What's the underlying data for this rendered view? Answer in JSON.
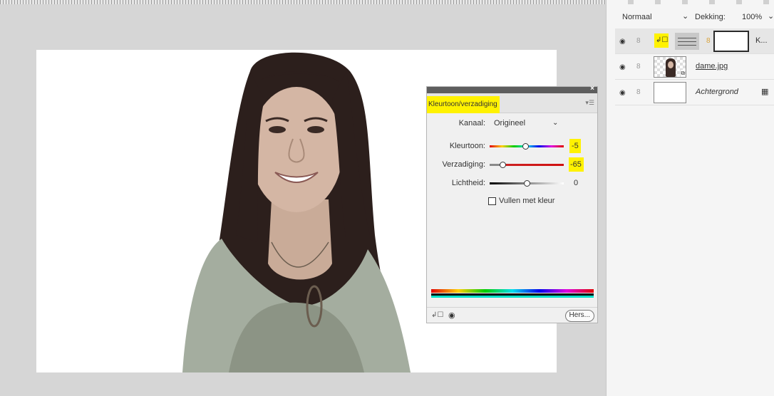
{
  "layers_panel": {
    "blend_mode": "Normaal",
    "opacity_label": "Dekking:",
    "opacity_value": "100%",
    "layers": [
      {
        "name": "K...",
        "type": "adjustment",
        "selected": true
      },
      {
        "name": "dame.jpg",
        "type": "smart-object"
      },
      {
        "name": "Achtergrond",
        "type": "background",
        "locked": true
      }
    ]
  },
  "properties_panel": {
    "title": "Kleurtoon/verzadiging",
    "channel_label": "Kanaal:",
    "channel_value": "Origineel",
    "sliders": [
      {
        "label": "Kleurtoon:",
        "value": "-5",
        "position": 0.48
      },
      {
        "label": "Verzadiging:",
        "value": "-65",
        "position": 0.17
      },
      {
        "label": "Lichtheid:",
        "value": "0",
        "position": 0.5
      }
    ],
    "colorize_label": "Vullen met kleur",
    "colorize_checked": false,
    "reset_label": "Hers..."
  },
  "colors": {
    "highlight": "#fff200",
    "panel_bg": "#f0f0f0",
    "canvas_bg": "#d6d6d6"
  }
}
